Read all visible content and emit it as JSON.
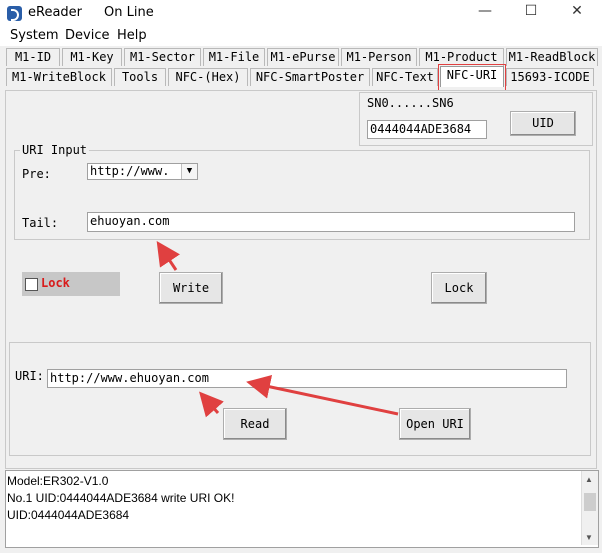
{
  "window": {
    "title": "eReader",
    "status": "On Line",
    "minimize": "—",
    "maximize": "☐",
    "close": "✕"
  },
  "menu": [
    "System",
    "Device",
    "Help"
  ],
  "tabs_row1": [
    "M1-ID",
    "M1-Key",
    "M1-Sector",
    "M1-File",
    "M1-ePurse",
    "M1-Person",
    "M1-Product",
    "M1-ReadBlock"
  ],
  "tabs_row2": [
    "M1-WriteBlock",
    "Tools",
    "NFC-(Hex)",
    "NFC-SmartPoster",
    "NFC-Text",
    "NFC-URI",
    "15693-ICODE"
  ],
  "sn": {
    "label": "SN0......SN6",
    "value": "0444044ADE3684",
    "button": "UID"
  },
  "uri_input": {
    "legend": "URI Input",
    "pre_label": "Pre:",
    "pre_value": "http://www.",
    "tail_label": "Tail:",
    "tail_value": "ehuoyan.com"
  },
  "lock_label": "Lock",
  "buttons": {
    "write": "Write",
    "lock": "Lock",
    "read": "Read",
    "open_uri": "Open URI"
  },
  "uri": {
    "label": "URI:",
    "value": "http://www.ehuoyan.com"
  },
  "log": [
    "Model:ER302-V1.0",
    "No.1 UID:0444044ADE3684 write URI OK!",
    "UID:0444044ADE3684"
  ],
  "colors": {
    "accent_red": "#e04040",
    "lock_red": "#d81b1b"
  }
}
